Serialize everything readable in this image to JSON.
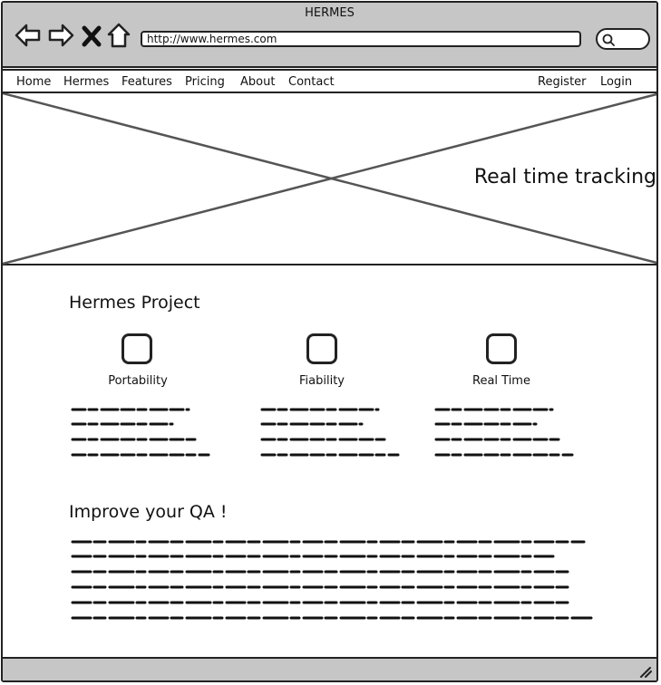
{
  "window": {
    "title": "HERMES"
  },
  "toolbar": {
    "buttons": [
      {
        "name": "back",
        "icon": "arrow-left-icon"
      },
      {
        "name": "forward",
        "icon": "arrow-right-icon"
      },
      {
        "name": "stop",
        "icon": "close-icon"
      },
      {
        "name": "home",
        "icon": "home-icon"
      }
    ],
    "url": "http://www.hermes.com",
    "search_icon": "search-icon"
  },
  "nav": {
    "left": [
      "Home",
      "Hermes",
      "Features",
      "Pricing",
      "About",
      "Contact"
    ],
    "right": [
      "Register",
      "Login"
    ]
  },
  "hero": {
    "image": "image-placeholder",
    "text": "Real time tracking"
  },
  "project": {
    "title": "Hermes Project",
    "features": [
      {
        "label": "Portability",
        "icon": "placeholder-square-icon"
      },
      {
        "label": "Fiability",
        "icon": "placeholder-square-icon"
      },
      {
        "label": "Real Time",
        "icon": "placeholder-square-icon"
      }
    ]
  },
  "qa": {
    "title": "Improve your QA !"
  },
  "colors": {
    "chrome": "#c6c6c6",
    "ink": "#222222",
    "background": "#ffffff"
  }
}
